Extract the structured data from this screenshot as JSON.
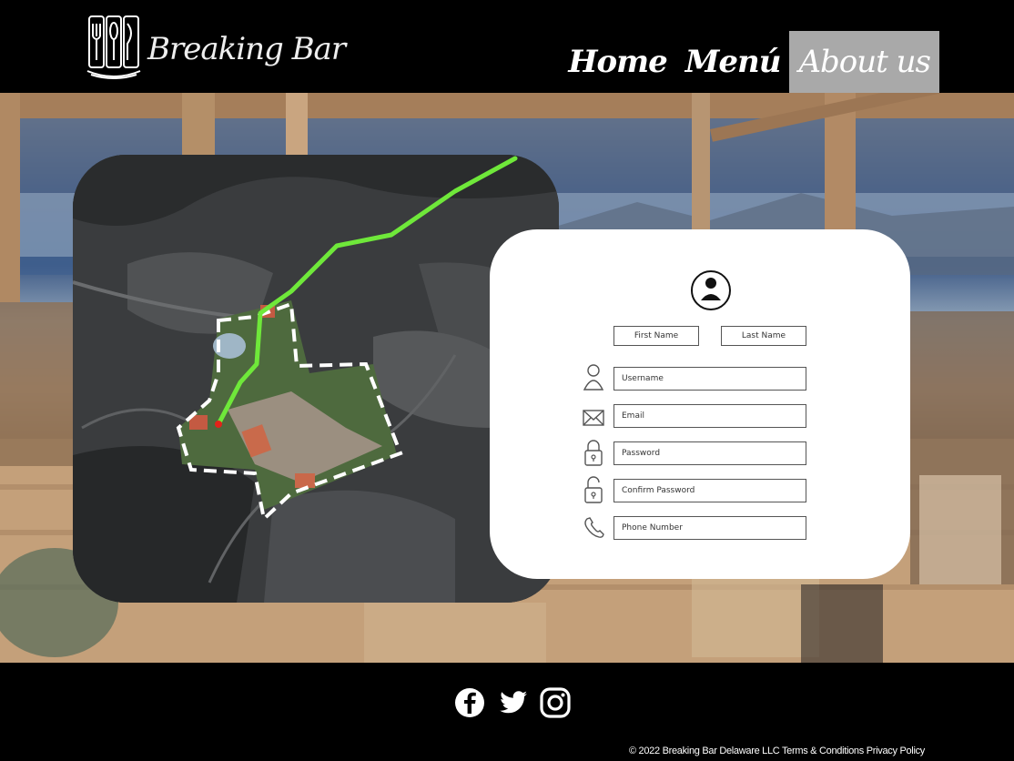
{
  "header": {
    "brand": "Breaking Bar",
    "nav": [
      {
        "label": "Home",
        "active": false
      },
      {
        "label": "Menú",
        "active": false
      },
      {
        "label": "About us",
        "active": true
      }
    ]
  },
  "form": {
    "first_name": "First Name",
    "last_name": "Last Name",
    "username": "Username",
    "email": "Email",
    "password": "Password",
    "confirm_password": "Confirm Password",
    "phone": "Phone Number"
  },
  "footer": {
    "copyright": "© 2022 Breaking Bar Delaware LLC",
    "terms": "Terms & Conditions",
    "privacy": "Privacy Policy"
  },
  "colors": {
    "route": "#6fe83a",
    "nav_active": "#a9a9a9",
    "header_bg": "#000000"
  },
  "icons": [
    "logo-icon",
    "user-avatar-icon",
    "person-icon",
    "envelope-icon",
    "lock-icon",
    "unlock-icon",
    "phone-icon",
    "facebook-icon",
    "twitter-icon",
    "instagram-icon"
  ]
}
